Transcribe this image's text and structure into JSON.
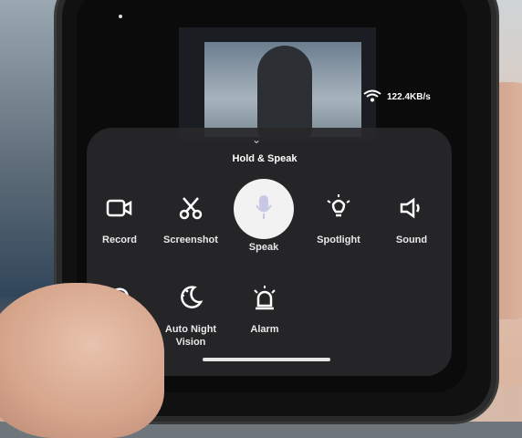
{
  "status": {
    "network_speed": "122.4KB/s"
  },
  "panel": {
    "title": "Hold & Speak",
    "row1": [
      {
        "label": "Record",
        "icon": "video-camera-icon"
      },
      {
        "label": "Screenshot",
        "icon": "scissors-icon"
      },
      {
        "label": "Speak",
        "icon": "microphone-icon"
      },
      {
        "label": "Spotlight",
        "icon": "lightbulb-icon"
      },
      {
        "label": "Sound",
        "icon": "speaker-icon"
      }
    ],
    "row2": [
      {
        "label": "",
        "icon": "history-icon"
      },
      {
        "label": "Auto Night Vision",
        "icon": "moon-icon"
      },
      {
        "label": "Alarm",
        "icon": "siren-icon"
      }
    ]
  }
}
